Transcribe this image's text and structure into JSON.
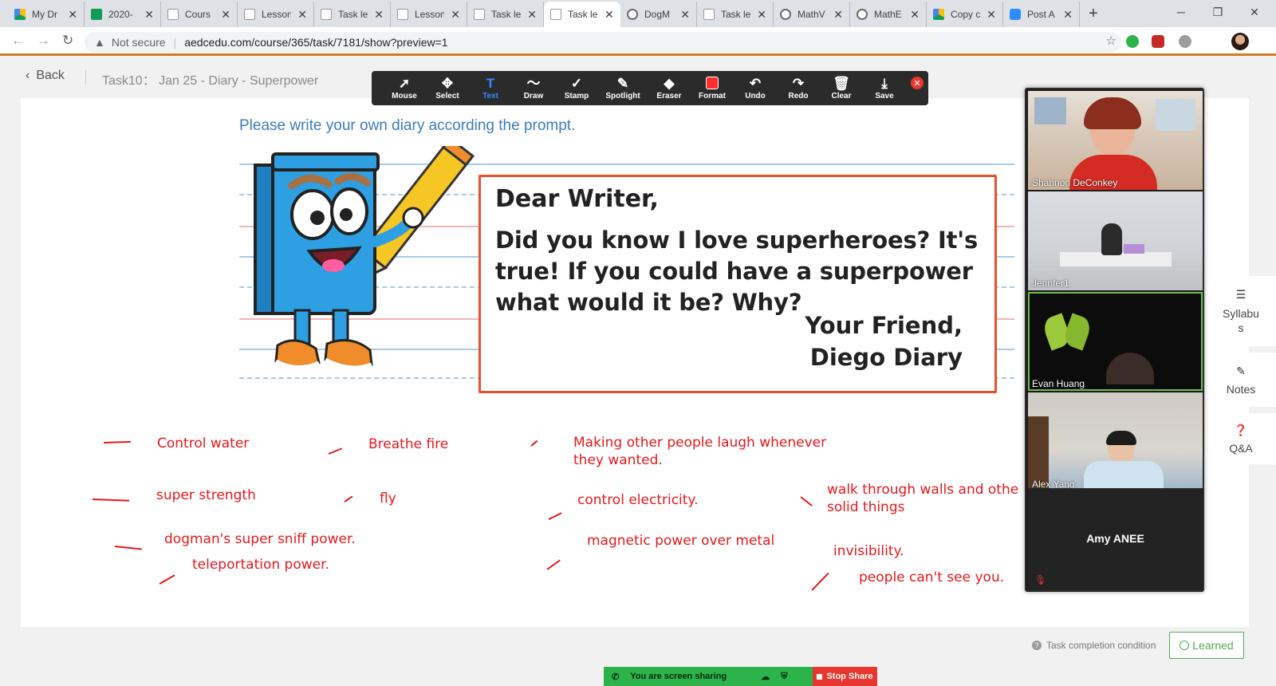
{
  "browser": {
    "tabs": [
      {
        "label": "My Dr",
        "favicon": "google-drive-icon"
      },
      {
        "label": "2020-",
        "favicon": "google-sheets-icon"
      },
      {
        "label": "Cours",
        "favicon": "document-icon"
      },
      {
        "label": "Lesson",
        "favicon": "document-icon"
      },
      {
        "label": "Task le",
        "favicon": "document-icon"
      },
      {
        "label": "Lesson",
        "favicon": "document-icon"
      },
      {
        "label": "Task le",
        "favicon": "document-icon"
      },
      {
        "label": "Task le",
        "favicon": "document-icon",
        "active": true
      },
      {
        "label": "DogM",
        "favicon": "globe-icon"
      },
      {
        "label": "Task le",
        "favicon": "document-icon"
      },
      {
        "label": "MathV",
        "favicon": "globe-icon"
      },
      {
        "label": "MathE",
        "favicon": "globe-icon"
      },
      {
        "label": "Copy c",
        "favicon": "google-drive-icon"
      },
      {
        "label": "Post A",
        "favicon": "zoom-icon"
      }
    ],
    "address": {
      "security": "Not secure",
      "url": "aedcedu.com/course/365/task/7181/show?preview=1"
    },
    "accent": "#d27a2a"
  },
  "page": {
    "back_label": "Back",
    "task_title": "Task10： Jan 25 - Diary - Superpower",
    "prompt": "Please write your own diary according the prompt.",
    "letter": {
      "greeting": "Dear Writer,",
      "line1": "Did you know I love superheroes? It's",
      "line2": "true! If you could have a superpower",
      "line3": "what would it be? Why?",
      "sign1": "Your Friend,",
      "sign2": "Diego Diary"
    },
    "annotations": {
      "a1": "Control water",
      "a2": "Breathe fire",
      "a3": "Making other people laugh whenever",
      "a3b": "they wanted.",
      "a4": "super strength",
      "a5": "fly",
      "a6": "control electricity.",
      "a7": "walk through walls and othe",
      "a7b": "solid things",
      "a8": "dogman's super sniff power.",
      "a9": "teleportation power.",
      "a10": "magnetic power over metal",
      "a11": "invisibility.",
      "a12": "people can't see you."
    },
    "annotation_color": "#e4191c",
    "prompt_color": "#3d7cb8",
    "task_condition": "Task completion condition",
    "learned_label": "Learned"
  },
  "zoom_toolbar": {
    "items": [
      "Mouse",
      "Select",
      "Text",
      "Draw",
      "Stamp",
      "Spotlight",
      "Eraser",
      "Format",
      "Undo",
      "Redo",
      "Clear",
      "Save"
    ],
    "selected": "Text"
  },
  "gallery": {
    "participants": [
      "Shannon DeConkey",
      "Jennfer1",
      "Evan Huang",
      "Alex Yang"
    ],
    "no_video": "Amy ANEE"
  },
  "side_panel": {
    "syllabus": "Syllabus",
    "notes": "Notes",
    "qa": "Q&A"
  },
  "share_bar": {
    "status": "You are screen sharing",
    "stop": "Stop Share"
  }
}
